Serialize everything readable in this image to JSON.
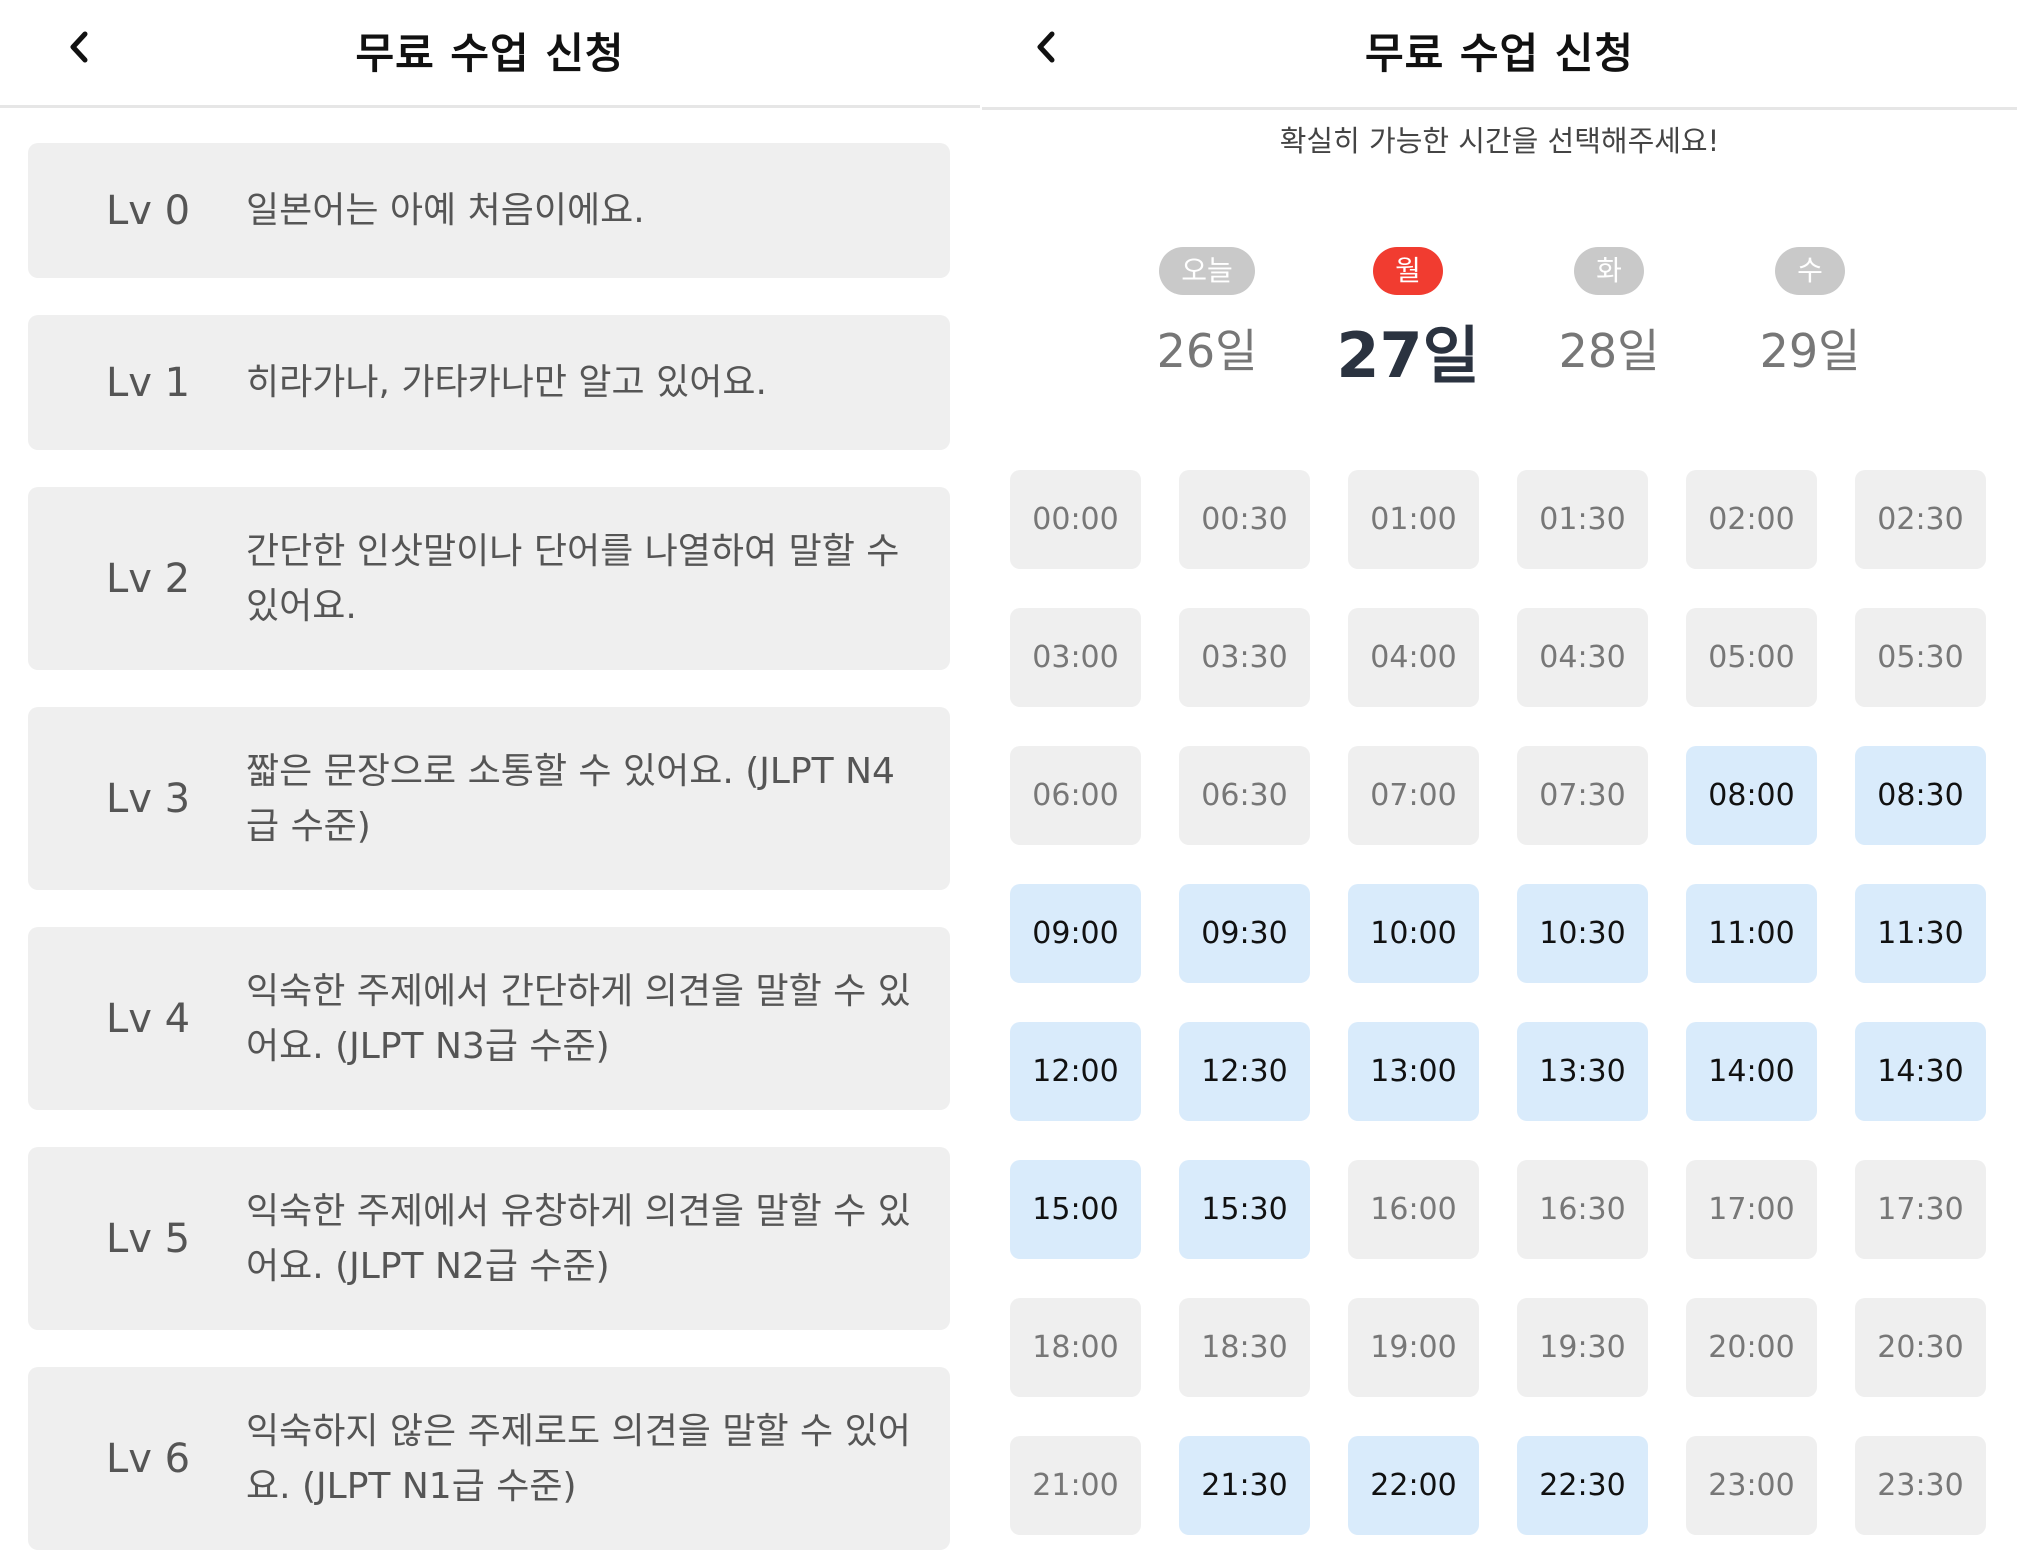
{
  "left": {
    "title": "무료 수업 신청",
    "levels": [
      {
        "lv": "Lv 0",
        "desc": "일본어는 아예 처음이에요."
      },
      {
        "lv": "Lv 1",
        "desc": "히라가나, 가타카나만 알고 있어요."
      },
      {
        "lv": "Lv 2",
        "desc": "간단한 인삿말이나 단어를 나열하여 말할 수 있어요."
      },
      {
        "lv": "Lv 3",
        "desc": "짧은 문장으로 소통할 수 있어요. (JLPT N4급 수준)"
      },
      {
        "lv": "Lv 4",
        "desc": "익숙한 주제에서 간단하게 의견을 말할 수 있어요. (JLPT N3급 수준)"
      },
      {
        "lv": "Lv 5",
        "desc": "익숙한 주제에서 유창하게 의견을 말할 수 있어요. (JLPT N2급 수준)"
      },
      {
        "lv": "Lv 6",
        "desc": "익숙하지 않은 주제로도 의견을 말할 수 있어요. (JLPT N1급 수준)"
      }
    ]
  },
  "right": {
    "title": "무료 수업 신청",
    "subtitle": "확실히 가능한 시간을 선택해주세요!",
    "days": [
      {
        "label": "오늘",
        "date": "26일",
        "selected": false
      },
      {
        "label": "월",
        "date": "27일",
        "selected": true
      },
      {
        "label": "화",
        "date": "28일",
        "selected": false
      },
      {
        "label": "수",
        "date": "29일",
        "selected": false
      }
    ],
    "slots": [
      {
        "time": "00:00",
        "available": false
      },
      {
        "time": "00:30",
        "available": false
      },
      {
        "time": "01:00",
        "available": false
      },
      {
        "time": "01:30",
        "available": false
      },
      {
        "time": "02:00",
        "available": false
      },
      {
        "time": "02:30",
        "available": false
      },
      {
        "time": "03:00",
        "available": false
      },
      {
        "time": "03:30",
        "available": false
      },
      {
        "time": "04:00",
        "available": false
      },
      {
        "time": "04:30",
        "available": false
      },
      {
        "time": "05:00",
        "available": false
      },
      {
        "time": "05:30",
        "available": false
      },
      {
        "time": "06:00",
        "available": false
      },
      {
        "time": "06:30",
        "available": false
      },
      {
        "time": "07:00",
        "available": false
      },
      {
        "time": "07:30",
        "available": false
      },
      {
        "time": "08:00",
        "available": true
      },
      {
        "time": "08:30",
        "available": true
      },
      {
        "time": "09:00",
        "available": true
      },
      {
        "time": "09:30",
        "available": true
      },
      {
        "time": "10:00",
        "available": true
      },
      {
        "time": "10:30",
        "available": true
      },
      {
        "time": "11:00",
        "available": true
      },
      {
        "time": "11:30",
        "available": true
      },
      {
        "time": "12:00",
        "available": true
      },
      {
        "time": "12:30",
        "available": true
      },
      {
        "time": "13:00",
        "available": true
      },
      {
        "time": "13:30",
        "available": true
      },
      {
        "time": "14:00",
        "available": true
      },
      {
        "time": "14:30",
        "available": true
      },
      {
        "time": "15:00",
        "available": true
      },
      {
        "time": "15:30",
        "available": true
      },
      {
        "time": "16:00",
        "available": false
      },
      {
        "time": "16:30",
        "available": false
      },
      {
        "time": "17:00",
        "available": false
      },
      {
        "time": "17:30",
        "available": false
      },
      {
        "time": "18:00",
        "available": false
      },
      {
        "time": "18:30",
        "available": false
      },
      {
        "time": "19:00",
        "available": false
      },
      {
        "time": "19:30",
        "available": false
      },
      {
        "time": "20:00",
        "available": false
      },
      {
        "time": "20:30",
        "available": false
      },
      {
        "time": "21:00",
        "available": false
      },
      {
        "time": "21:30",
        "available": true
      },
      {
        "time": "22:00",
        "available": true
      },
      {
        "time": "22:30",
        "available": true
      },
      {
        "time": "23:00",
        "available": false
      },
      {
        "time": "23:30",
        "available": false
      }
    ]
  },
  "colors": {
    "accent_red": "#f13c30",
    "available_bg": "#d9ebfb",
    "unavailable_bg": "#efefef",
    "pill_gray": "#c9c9c9"
  },
  "icons": {
    "back": "chevron-left-icon"
  }
}
